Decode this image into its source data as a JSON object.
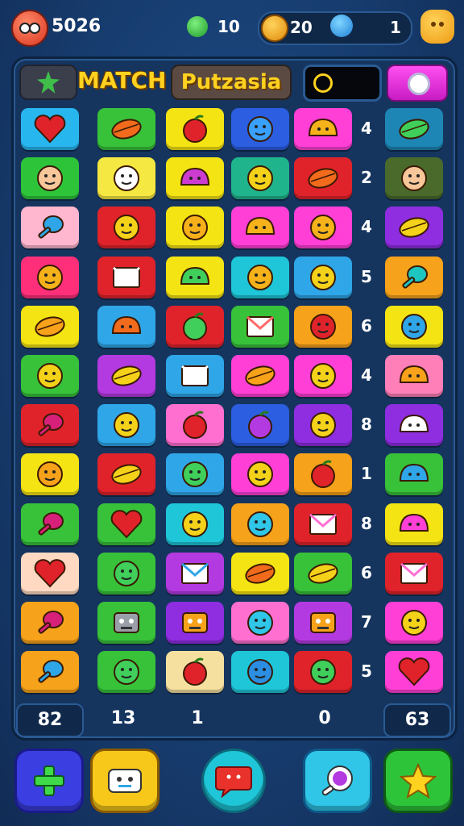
{
  "topbar": {
    "coins": "5026",
    "gems": "10",
    "gold": "20",
    "blue": "1"
  },
  "header": {
    "title_left": "MATCH",
    "title_right": "Putzasia"
  },
  "board": {
    "rows": [
      {
        "tiles": [
          {
            "bg": "#28b6ef",
            "shape": "heart",
            "color": "#e0232b"
          },
          {
            "bg": "#38c23a",
            "shape": "leaf",
            "color": "#f26b1d"
          },
          {
            "bg": "#f5e414",
            "shape": "apple",
            "color": "#e0232b"
          },
          {
            "bg": "#2b5ee0",
            "shape": "face",
            "color": "#3aa0ff"
          },
          {
            "bg": "#ff3fd6",
            "shape": "blob",
            "color": "#f5b21a"
          },
          {
            "bg": "#1e86b4",
            "shape": "leaf",
            "color": "#3fcf5a"
          }
        ],
        "num": "4"
      },
      {
        "tiles": [
          {
            "bg": "#2ec43a",
            "shape": "face",
            "color": "#f7c79a"
          },
          {
            "bg": "#f6e842",
            "shape": "face",
            "color": "#ffffff"
          },
          {
            "bg": "#f5e414",
            "shape": "blob",
            "color": "#cc3cd0"
          },
          {
            "bg": "#20b48c",
            "shape": "face",
            "color": "#f5d21a"
          },
          {
            "bg": "#e0232b",
            "shape": "leaf",
            "color": "#f26b1d"
          },
          {
            "bg": "#4a6a2c",
            "shape": "face",
            "color": "#f7c79a"
          }
        ],
        "num": "2"
      },
      {
        "tiles": [
          {
            "bg": "#ffb6cf",
            "shape": "drop",
            "color": "#2fa6e8"
          },
          {
            "bg": "#e0232b",
            "shape": "face",
            "color": "#f5d21a"
          },
          {
            "bg": "#f5e414",
            "shape": "face",
            "color": "#f7b01a"
          },
          {
            "bg": "#ff3fd6",
            "shape": "blob",
            "color": "#f5b21a"
          },
          {
            "bg": "#ff3fd6",
            "shape": "face",
            "color": "#f5b21a"
          },
          {
            "bg": "#8e2ee0",
            "shape": "leaf",
            "color": "#f5d21a"
          }
        ],
        "num": "4"
      },
      {
        "tiles": [
          {
            "bg": "#ff2f7a",
            "shape": "face",
            "color": "#f5b21a"
          },
          {
            "bg": "#e0232b",
            "shape": "env",
            "color": "#ffffff"
          },
          {
            "bg": "#f5e414",
            "shape": "blob",
            "color": "#3fcf5a"
          },
          {
            "bg": "#1ec6d8",
            "shape": "face",
            "color": "#f5b21a"
          },
          {
            "bg": "#2fa6e8",
            "shape": "face",
            "color": "#f5d21a"
          },
          {
            "bg": "#f6a21a",
            "shape": "drop",
            "color": "#1ec6c0"
          }
        ],
        "num": "5"
      },
      {
        "tiles": [
          {
            "bg": "#f5e414",
            "shape": "leaf",
            "color": "#f7a21a"
          },
          {
            "bg": "#2fa6e8",
            "shape": "blob",
            "color": "#f26b1d"
          },
          {
            "bg": "#e0232b",
            "shape": "apple",
            "color": "#3fcf5a"
          },
          {
            "bg": "#38c23a",
            "shape": "env",
            "color": "#ff6a6a"
          },
          {
            "bg": "#f6a21a",
            "shape": "face",
            "color": "#e0232b"
          },
          {
            "bg": "#f5e414",
            "shape": "face",
            "color": "#2fa6e8"
          }
        ],
        "num": "6"
      },
      {
        "tiles": [
          {
            "bg": "#38c23a",
            "shape": "face",
            "color": "#f5d21a"
          },
          {
            "bg": "#b33ae0",
            "shape": "leaf",
            "color": "#f5d21a"
          },
          {
            "bg": "#2fa6e8",
            "shape": "env",
            "color": "#ffffff"
          },
          {
            "bg": "#ff3fd6",
            "shape": "leaf",
            "color": "#f7a21a"
          },
          {
            "bg": "#ff3fd6",
            "shape": "face",
            "color": "#f5d21a"
          },
          {
            "bg": "#ff7fb8",
            "shape": "blob",
            "color": "#f7a21a"
          }
        ],
        "num": "4"
      },
      {
        "tiles": [
          {
            "bg": "#e0232b",
            "shape": "drop",
            "color": "#d6207a"
          },
          {
            "bg": "#2fa6e8",
            "shape": "face",
            "color": "#f5d21a"
          },
          {
            "bg": "#ff6fd0",
            "shape": "apple",
            "color": "#e0232b"
          },
          {
            "bg": "#2b5ee0",
            "shape": "apple",
            "color": "#b33ae0"
          },
          {
            "bg": "#8e2ee0",
            "shape": "face",
            "color": "#f5d21a"
          },
          {
            "bg": "#8e2ee0",
            "shape": "blob",
            "color": "#ffffff"
          }
        ],
        "num": "8"
      },
      {
        "tiles": [
          {
            "bg": "#f5e414",
            "shape": "face",
            "color": "#f7a21a"
          },
          {
            "bg": "#e0232b",
            "shape": "leaf",
            "color": "#f5d21a"
          },
          {
            "bg": "#2fa6e8",
            "shape": "face",
            "color": "#3fcf5a"
          },
          {
            "bg": "#ff3fd6",
            "shape": "face",
            "color": "#f5d21a"
          },
          {
            "bg": "#f6a21a",
            "shape": "apple",
            "color": "#e0232b"
          },
          {
            "bg": "#38c23a",
            "shape": "blob",
            "color": "#2fa6e8"
          }
        ],
        "num": "1"
      },
      {
        "tiles": [
          {
            "bg": "#38c23a",
            "shape": "drop",
            "color": "#d6207a"
          },
          {
            "bg": "#38c23a",
            "shape": "heart",
            "color": "#e0232b"
          },
          {
            "bg": "#1ec6d8",
            "shape": "face",
            "color": "#f5d21a"
          },
          {
            "bg": "#f6a21a",
            "shape": "face",
            "color": "#2fc6e8"
          },
          {
            "bg": "#e0232b",
            "shape": "env",
            "color": "#ff6fd0"
          },
          {
            "bg": "#f5e414",
            "shape": "blob",
            "color": "#ff3fd6"
          }
        ],
        "num": "8"
      },
      {
        "tiles": [
          {
            "bg": "#ffd9c2",
            "shape": "heart",
            "color": "#e0232b"
          },
          {
            "bg": "#38c23a",
            "shape": "face",
            "color": "#3fcf5a"
          },
          {
            "bg": "#b33ae0",
            "shape": "env",
            "color": "#2fa6e8"
          },
          {
            "bg": "#f5e414",
            "shape": "leaf",
            "color": "#f26b1d"
          },
          {
            "bg": "#38c23a",
            "shape": "leaf",
            "color": "#f5d21a"
          },
          {
            "bg": "#e0232b",
            "shape": "env",
            "color": "#ff6fd0"
          }
        ],
        "num": "6"
      },
      {
        "tiles": [
          {
            "bg": "#f6a21a",
            "shape": "drop",
            "color": "#d6207a"
          },
          {
            "bg": "#38c23a",
            "shape": "robot",
            "color": "#9aa0aa"
          },
          {
            "bg": "#8e2ee0",
            "shape": "robot",
            "color": "#f6a21a"
          },
          {
            "bg": "#ff6fd0",
            "shape": "face",
            "color": "#2fc6e8"
          },
          {
            "bg": "#b33ae0",
            "shape": "robot",
            "color": "#f6a21a"
          },
          {
            "bg": "#ff3fd6",
            "shape": "face",
            "color": "#f5d21a"
          }
        ],
        "num": "7"
      },
      {
        "tiles": [
          {
            "bg": "#f6a21a",
            "shape": "drop",
            "color": "#2fa6e8"
          },
          {
            "bg": "#38c23a",
            "shape": "face",
            "color": "#3fcf5a"
          },
          {
            "bg": "#f6e0a0",
            "shape": "apple",
            "color": "#e0232b"
          },
          {
            "bg": "#1ec6d8",
            "shape": "face",
            "color": "#2b8ee0"
          },
          {
            "bg": "#e0232b",
            "shape": "face",
            "color": "#3fcf5a"
          },
          {
            "bg": "#ff3fd6",
            "shape": "heart",
            "color": "#e0232b"
          }
        ],
        "num": "5"
      }
    ]
  },
  "footer": {
    "cells": [
      "82",
      "13",
      "1",
      "0",
      "63"
    ]
  },
  "bottom": {
    "buttons": [
      {
        "name": "add-button",
        "bg": "#3b3ee0",
        "icon": "plus-icon"
      },
      {
        "name": "robot-button",
        "bg": "#f7c81a",
        "icon": "robot-icon"
      },
      {
        "name": "chat-button",
        "bg": "#1ec6d8",
        "icon": "chat-icon"
      },
      {
        "name": "potion-button",
        "bg": "#2fc6e8",
        "icon": "potion-icon"
      },
      {
        "name": "star-button",
        "bg": "#2ec43a",
        "icon": "star-icon"
      }
    ]
  }
}
